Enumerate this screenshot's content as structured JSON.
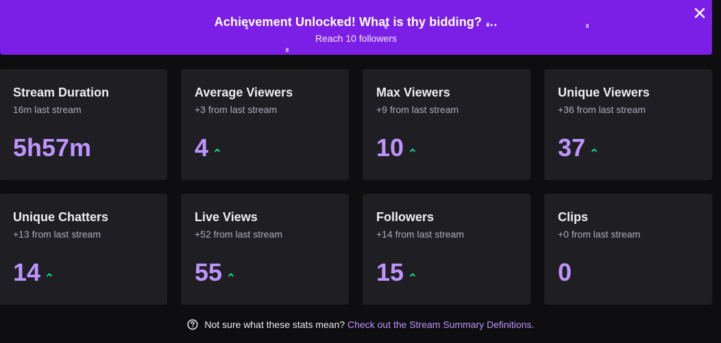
{
  "banner": {
    "title": "Achievement Unlocked! What is thy bidding? …",
    "subtitle": "Reach 10 followers",
    "background": "#7b1fe6"
  },
  "close_icon": "close-icon",
  "stats": [
    {
      "title": "Stream Duration",
      "sub": "16m last stream",
      "value": "5h57m",
      "trend": ""
    },
    {
      "title": "Average Viewers",
      "sub": "+3 from last stream",
      "value": "4",
      "trend": "up"
    },
    {
      "title": "Max Viewers",
      "sub": "+9 from last stream",
      "value": "10",
      "trend": "up"
    },
    {
      "title": "Unique Viewers",
      "sub": "+36 from last stream",
      "value": "37",
      "trend": "up"
    },
    {
      "title": "Unique Chatters",
      "sub": "+13 from last stream",
      "value": "14",
      "trend": "up"
    },
    {
      "title": "Live Views",
      "sub": "+52 from last stream",
      "value": "55",
      "trend": "up"
    },
    {
      "title": "Followers",
      "sub": "+14 from last stream",
      "value": "15",
      "trend": "up"
    },
    {
      "title": "Clips",
      "sub": "+0 from last stream",
      "value": "0",
      "trend": ""
    }
  ],
  "footer": {
    "question": "Not sure what these stats mean?",
    "link": "Check out the Stream Summary Definitions."
  },
  "colors": {
    "accent": "#bf94ff",
    "trend_up": "#00f593",
    "card_bg": "#1f1f23",
    "page_bg": "#0e0e10"
  }
}
